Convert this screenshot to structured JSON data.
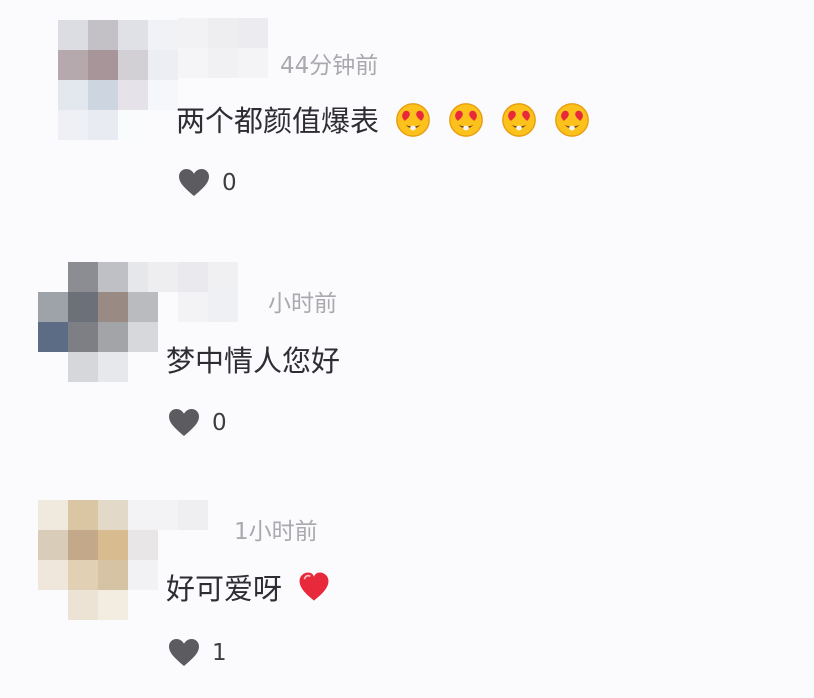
{
  "comments": [
    {
      "time": "44分钟前",
      "text": "两个都颜值爆表",
      "emojis": [
        "heart-eyes-emoji",
        "heart-eyes-emoji",
        "heart-eyes-emoji",
        "heart-eyes-emoji"
      ],
      "likes": "0"
    },
    {
      "time": "小时前",
      "text": "梦中情人您好",
      "emojis": [],
      "likes": "0"
    },
    {
      "time": "1小时前",
      "text": "好可爱呀",
      "emojis": [
        "red-heart-emoji"
      ],
      "likes": "1"
    }
  ],
  "colors": {
    "background": "#fbfbfd",
    "time_text": "#a9a9ae",
    "body_text": "#2d2d33",
    "like_icon": "#5b5b60"
  }
}
